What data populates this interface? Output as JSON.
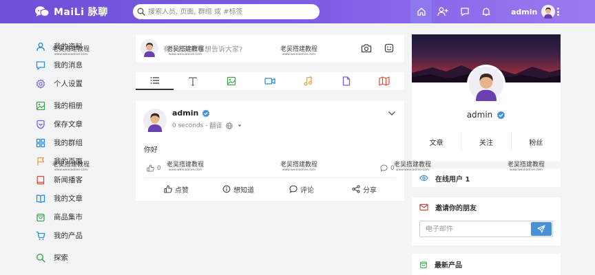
{
  "topbar": {
    "brand": "MaiLi 脉聊",
    "search_placeholder": "搜索人员, 页面, 群组 或 #标签",
    "user_name": "admin"
  },
  "sidebar": {
    "items": [
      {
        "label": "我的资料",
        "icon": "user-icon",
        "color": "#2a8fd0"
      },
      {
        "label": "我的消息",
        "icon": "chat-icon",
        "color": "#2a8fd0"
      },
      {
        "label": "个人设置",
        "icon": "gear-icon",
        "color": "#7b5ce6"
      },
      {
        "label": "我的相册",
        "icon": "image-icon",
        "color": "#3aa84a"
      },
      {
        "label": "保存文章",
        "icon": "bookmark-icon",
        "color": "#7b5ce6"
      },
      {
        "label": "我的群组",
        "icon": "grid-icon",
        "color": "#2a8fd0"
      },
      {
        "label": "我的页面",
        "icon": "flag-icon",
        "color": "#e8a33c"
      },
      {
        "label": "新闻播客",
        "icon": "book-icon",
        "color": "#e24a3b"
      },
      {
        "label": "我的文章",
        "icon": "open-book-icon",
        "color": "#2a8fd0"
      },
      {
        "label": "商品集市",
        "icon": "shop-bag-icon",
        "color": "#3aa84a"
      },
      {
        "label": "我的产品",
        "icon": "cart-icon",
        "color": "#2a8fd0"
      },
      {
        "label": "探索",
        "icon": "search-icon",
        "color": "#3aa84a"
      }
    ]
  },
  "composer": {
    "placeholder": "有什么新鲜事想告诉大家?"
  },
  "post": {
    "author": "admin",
    "time": "0 seconds",
    "translate": "翻译",
    "body": "你好",
    "likes": "0",
    "comments": "0",
    "actions": {
      "like": "点赞",
      "wonder": "想知道",
      "comment": "评论",
      "share": "分享"
    }
  },
  "profile": {
    "name": "admin",
    "stats": [
      "文章",
      "关注",
      "粉丝"
    ]
  },
  "widgets": {
    "online_users": "在线用户 1",
    "invite_title": "邀请你的朋友",
    "email_placeholder": "电子邮件",
    "new_products": "最新产品"
  },
  "watermark": {
    "text": "老吴搭建教程",
    "url": "www.weixiaolive.com"
  },
  "colors": {
    "brand_purple": "#7b5ce6",
    "send_blue": "#4a90d9",
    "verified_blue": "#4a90d9"
  }
}
